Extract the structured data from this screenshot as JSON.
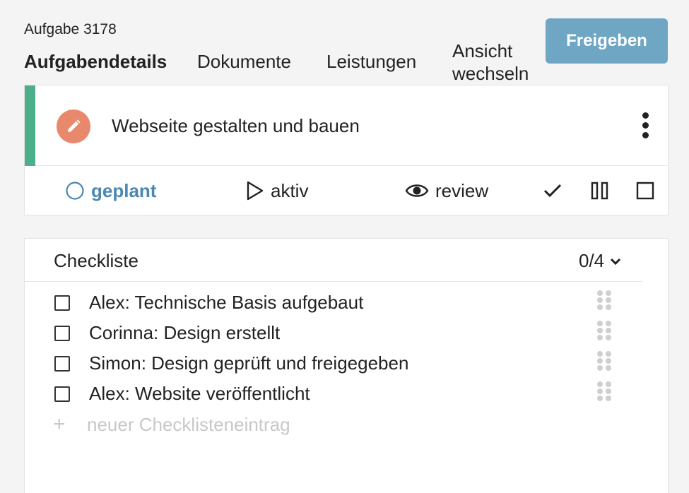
{
  "task": {
    "number_label": "Aufgabe 3178",
    "title": "Webseite gestalten und bauen",
    "accent_color": "#4caf8a",
    "edit_badge_color": "#e8896e"
  },
  "tabs": [
    {
      "label": "Aufgabendetails",
      "active": true
    },
    {
      "label": "Dokumente",
      "active": false
    },
    {
      "label": "Leistungen",
      "active": false
    },
    {
      "label": "Ansicht wechseln",
      "active": false
    }
  ],
  "release_button": {
    "label": "Freigeben",
    "color": "#6ea6c4"
  },
  "status": {
    "selected": "geplant",
    "selected_color": "#4a88b2",
    "options": [
      {
        "label": "geplant",
        "icon": "circle-icon"
      },
      {
        "label": "aktiv",
        "icon": "play-icon"
      },
      {
        "label": "review",
        "icon": "eye-icon"
      }
    ],
    "icon_actions": [
      "check-icon",
      "pause-icon",
      "stop-icon"
    ]
  },
  "checklist": {
    "title": "Checkliste",
    "count": "0/4",
    "items": [
      {
        "label": "Alex: Technische Basis aufgebaut",
        "checked": false
      },
      {
        "label": "Corinna: Design erstellt",
        "checked": false
      },
      {
        "label": "Simon: Design geprüft und freigegeben",
        "checked": false
      },
      {
        "label": "Alex: Website veröffentlicht",
        "checked": false
      }
    ],
    "new_entry_placeholder": "neuer Checklisteneintrag"
  }
}
